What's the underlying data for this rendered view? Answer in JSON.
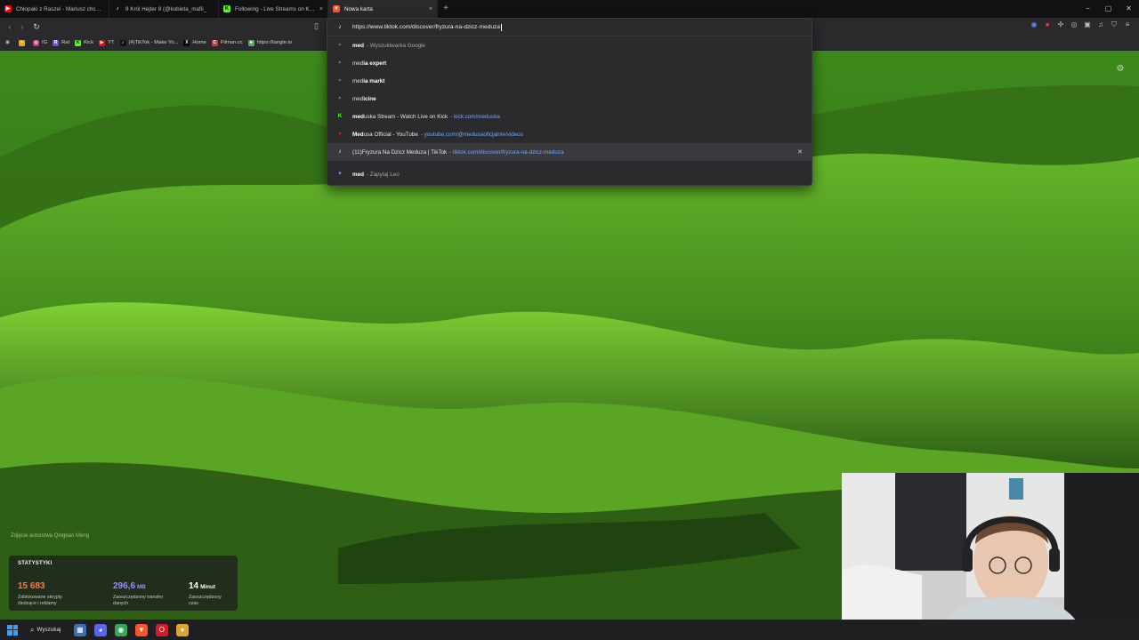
{
  "tabs": [
    {
      "label": "Chłopaki z Raszei - Mariusz chce zap",
      "favicon": "youtube-icon",
      "color": "#ff0000",
      "active": false,
      "close": "×"
    },
    {
      "label": "8 Król Hejter 8 (@kobieta_mafii_",
      "favicon": "tiktok-icon",
      "color": "#111111",
      "active": false,
      "close": "×"
    },
    {
      "label": "Following - Live Streams on Kick",
      "favicon": "kick-icon",
      "color": "#53fc18",
      "active": false,
      "close": "×"
    },
    {
      "label": "Nowa karta",
      "favicon": "brave-icon",
      "color": "#fb542b",
      "active": true,
      "close": "×"
    }
  ],
  "new_tab_label": "+",
  "window_controls": {
    "minimize": "−",
    "maximize": "▢",
    "close": "✕"
  },
  "omnibox": {
    "url": "https://www.tiktok.com/discover/fryzura-na-dzicz-meduza",
    "suggestions": [
      {
        "icon": "search-icon",
        "bold": "med",
        "rest": "",
        "suffix": "- Wyszukiwarka Google",
        "url": "",
        "highlight": false
      },
      {
        "icon": "search-icon",
        "bold": "",
        "rest": "med",
        "boldtail": "ia expert",
        "suffix": "",
        "url": "",
        "highlight": false
      },
      {
        "icon": "search-icon",
        "bold": "",
        "rest": "med",
        "boldtail": "ia markt",
        "suffix": "",
        "url": "",
        "highlight": false
      },
      {
        "icon": "search-icon",
        "bold": "",
        "rest": "med",
        "boldtail": "icine",
        "suffix": "",
        "url": "",
        "highlight": false
      },
      {
        "icon": "kick-icon",
        "bold": "med",
        "rest": "uska Stream - Watch Live on Kick",
        "suffix": "",
        "url": "- kick.com/meduska",
        "highlight": false
      },
      {
        "icon": "youtube-icon",
        "bold": "Med",
        "rest": "usa Official - YouTube",
        "suffix": "",
        "url": "- youtube.com/@medusaoficjalnie/videos",
        "highlight": false
      },
      {
        "icon": "tiktok-icon",
        "bold": "",
        "rest": "(11)Fryzura Na Dzicz Meduza | TikTok",
        "suffix": "",
        "url": "- tiktok.com/discover/fryzura-na-dzicz-meduza",
        "highlight": true
      },
      {
        "icon": "leo-icon",
        "bold": "med",
        "rest": "",
        "suffix": "- Zapytaj Leo",
        "url": "",
        "highlight": false
      }
    ]
  },
  "bookmarks": [
    {
      "label": "",
      "icon": "apps-grid-icon",
      "color": "#2a2a2d"
    },
    {
      "label": "",
      "icon": "bookmark-icon",
      "color": "#f2a900"
    },
    {
      "label": "IG",
      "icon": "instagram-icon",
      "color": "#d62976"
    },
    {
      "label": "Rat",
      "icon": "rat-icon",
      "color": "#7b4bd6"
    },
    {
      "label": "Kick",
      "icon": "kick-icon",
      "color": "#53fc18"
    },
    {
      "label": "YT",
      "icon": "youtube-icon",
      "color": "#ff0000"
    },
    {
      "label": "(4)TikTok - Make Yo...",
      "icon": "tiktok-icon",
      "color": "#111111"
    },
    {
      "label": "Home",
      "icon": "x-icon",
      "color": "#000000"
    },
    {
      "label": "Filman.cc",
      "icon": "filman-icon",
      "color": "#cc3b3b"
    },
    {
      "label": "https://tangle.io",
      "icon": "tangle-icon",
      "color": "#4caf50"
    }
  ],
  "wallpaper_credit": "Zdjęcie autorstwa Qingbao Meng",
  "stats": {
    "title": "STATYSTYKI",
    "items": [
      {
        "value": "15 683",
        "unit": "",
        "desc": "Zablokowane skrypty śledzące i reklamy",
        "color": "#ff7a45"
      },
      {
        "value": "296,6",
        "unit": "MB",
        "desc": "Zaoszczędzony transfer danych",
        "color": "#9a8cff"
      },
      {
        "value": "14",
        "unit": "Minut",
        "desc": "Zaoszczędzony czas",
        "color": "#ffffff"
      }
    ]
  },
  "taskbar": {
    "search_label": "Wyszukaj",
    "apps": [
      {
        "icon": "file-explorer-icon",
        "color": "#3d6fb0"
      },
      {
        "icon": "discord-icon",
        "color": "#5865f2"
      },
      {
        "icon": "chrome-icon",
        "color": "#34a853"
      },
      {
        "icon": "brave-icon",
        "color": "#fb542b"
      },
      {
        "icon": "opera-icon",
        "color": "#d21c2b"
      },
      {
        "icon": "app-icon",
        "color": "#e0a530"
      }
    ]
  }
}
